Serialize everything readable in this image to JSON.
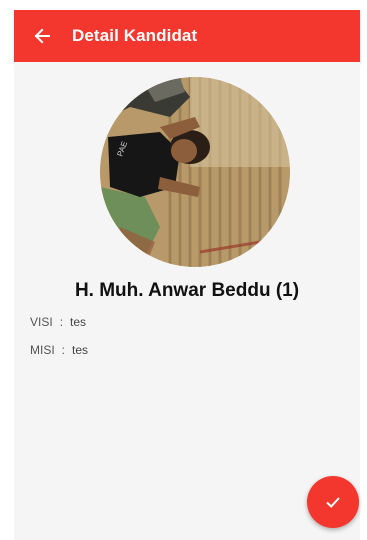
{
  "app_bar": {
    "title": "Detail Kandidat",
    "back_icon": "arrow-left-icon",
    "color": "#f4372e"
  },
  "candidate": {
    "name": "H. Muh. Anwar Beddu (1)",
    "photo": "candidate-photo",
    "visi_label": "VISI",
    "visi_value": "tes",
    "misi_label": "MISI",
    "misi_value": "tes",
    "separator": ":"
  },
  "fab": {
    "icon": "check-icon",
    "color": "#f4372e"
  }
}
